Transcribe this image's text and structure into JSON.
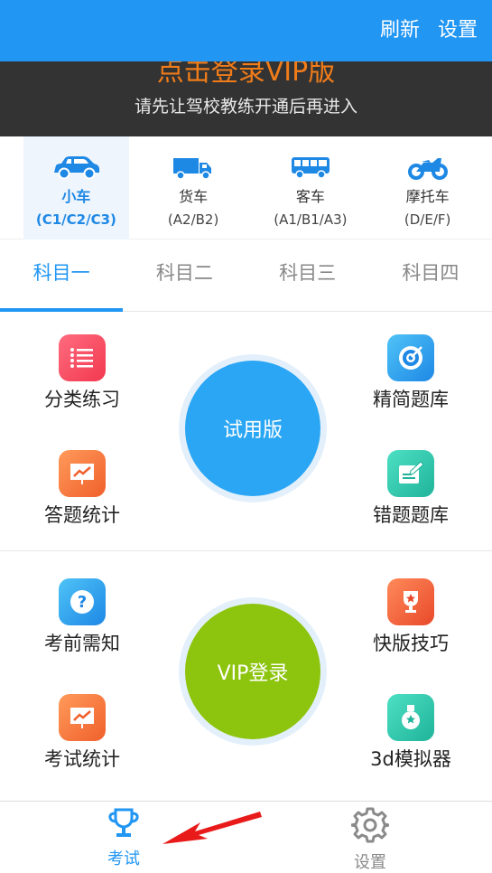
{
  "topbar": {
    "refresh_label": "刷新",
    "settings_label": "设置",
    "color": "#2196F3"
  },
  "banner": {
    "title": "点击登录VIP版",
    "subtitle": "请先让驾校教练开通后再进入"
  },
  "vehicles": [
    {
      "name": "小车",
      "code": "(C1/C2/C3)",
      "icon": "car-icon",
      "selected": true
    },
    {
      "name": "货车",
      "code": "(A2/B2)",
      "icon": "truck-icon",
      "selected": false
    },
    {
      "name": "客车",
      "code": "(A1/B1/A3)",
      "icon": "bus-icon",
      "selected": false
    },
    {
      "name": "摩托车",
      "code": "(D/E/F)",
      "icon": "motorcycle-icon",
      "selected": false
    }
  ],
  "tabs": [
    {
      "label": "科目一",
      "selected": true
    },
    {
      "label": "科目二",
      "selected": false
    },
    {
      "label": "科目三",
      "selected": false
    },
    {
      "label": "科目四",
      "selected": false
    }
  ],
  "section1": {
    "items": [
      {
        "label": "分类练习",
        "icon": "list-icon"
      },
      {
        "label": "精简题库",
        "icon": "target-icon"
      },
      {
        "label": "答题统计",
        "icon": "chart-board-icon"
      },
      {
        "label": "错题题库",
        "icon": "edit-note-icon"
      }
    ],
    "center_label": "试用版"
  },
  "section2": {
    "items": [
      {
        "label": "考前需知",
        "icon": "question-icon"
      },
      {
        "label": "快版技巧",
        "icon": "trophy-star-icon"
      },
      {
        "label": "考试统计",
        "icon": "chart-board-icon"
      },
      {
        "label": "3d模拟器",
        "icon": "medal-icon"
      }
    ],
    "center_label": "VIP登录"
  },
  "bottomnav": {
    "exam_label": "考试",
    "settings_label": "设置"
  }
}
